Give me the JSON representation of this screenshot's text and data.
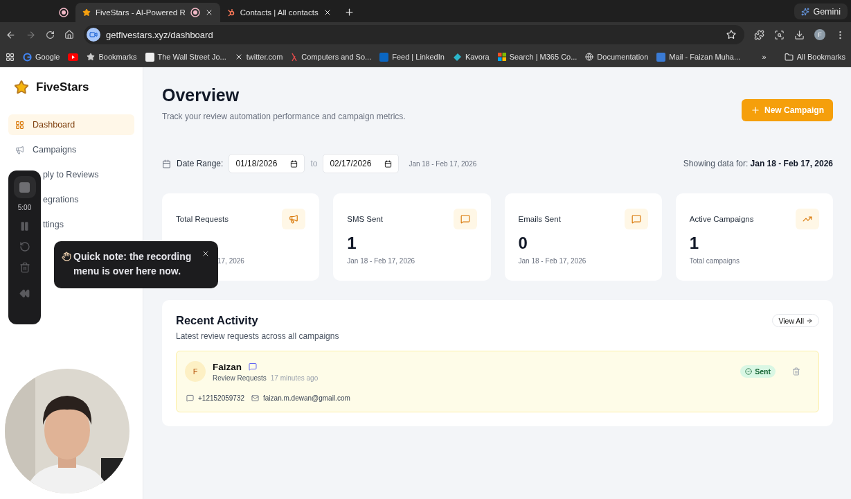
{
  "browser": {
    "tabs": [
      {
        "recording": true,
        "selected": false
      },
      {
        "title": "FiveStars - AI-Powered R",
        "recording": true,
        "selected": true
      },
      {
        "title": "Contacts | All contacts",
        "recording": false,
        "selected": false
      }
    ],
    "gemini": "Gemini",
    "url": "getfivestars.xyz/dashboard",
    "profile": "F",
    "bookmarks": [
      "Google",
      "Bookmarks",
      "The Wall Street Jo...",
      "twitter.com",
      "Computers and So...",
      "Feed | LinkedIn",
      "Kavora",
      "Search | M365 Co...",
      "Documentation",
      "Mail - Faizan Muha..."
    ],
    "more": "»",
    "all_bookmarks": "All Bookmarks"
  },
  "sidebar": {
    "brand": "FiveStars",
    "items": [
      {
        "label": "Dashboard",
        "selected": true,
        "kind": "full"
      },
      {
        "label": "Campaigns",
        "selected": false,
        "kind": "full"
      },
      {
        "label": "ply to Reviews",
        "selected": false,
        "kind": "covered"
      },
      {
        "label": "egrations",
        "selected": false,
        "kind": "covered"
      },
      {
        "label": "ttings",
        "selected": false,
        "kind": "covered"
      }
    ]
  },
  "header": {
    "title": "Overview",
    "subtitle": "Track your review automation performance and campaign metrics.",
    "button": "New Campaign"
  },
  "date_range": {
    "label": "Date Range:",
    "from": "01/18/2026",
    "to_label": "to",
    "to": "02/17/2026",
    "summary": "Jan 18 - Feb 17, 2026",
    "showing": "Showing data for: **Jan 18 - Feb 17, 2026**"
  },
  "stats": [
    {
      "label": "Total Requests",
      "note": "17, 2026",
      "kind": "covered"
    },
    {
      "label": "SMS Sent",
      "value": "1",
      "note": "Jan 18 - Feb 17, 2026",
      "kind": "full"
    },
    {
      "label": "Emails Sent",
      "value": "0",
      "note": "Jan 18 - Feb 17, 2026",
      "kind": "full"
    },
    {
      "label": "Active Campaigns",
      "value": "1",
      "note": "Total campaigns",
      "kind": "full"
    }
  ],
  "recent": {
    "title": "Recent Activity",
    "subtitle": "Latest review requests across all campaigns",
    "view_all": "View All",
    "items": [
      {
        "initial": "F",
        "name": "Faizan",
        "source": "Review Requests",
        "time": "17 minutes ago",
        "status": "Sent",
        "phone": "+12152059732",
        "email": "faizan.m.dewan@gmail.com"
      }
    ]
  },
  "recorder": {
    "time": "5:00"
  },
  "tooltip": {
    "text": "Quick note: the recording menu is over here now."
  }
}
